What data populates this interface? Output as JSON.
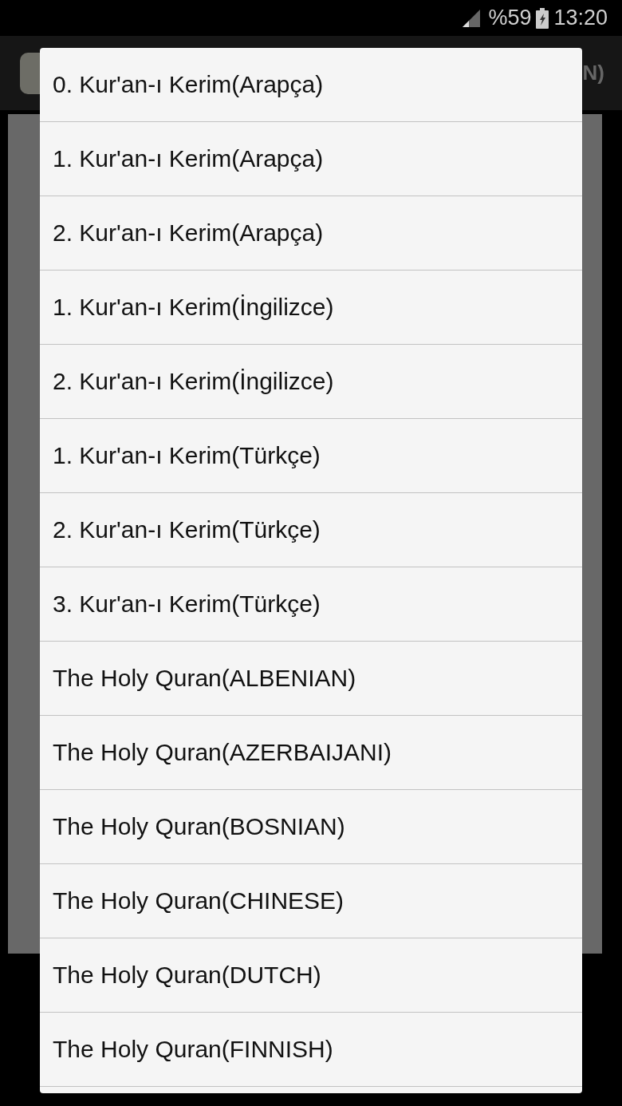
{
  "status_bar": {
    "battery": "%59",
    "time": "13:20"
  },
  "app_bar": {
    "title_fragment": "N)"
  },
  "dialog": {
    "items": [
      {
        "label": "0. Kur'an-ı Kerim(Arapça)"
      },
      {
        "label": "1. Kur'an-ı Kerim(Arapça)"
      },
      {
        "label": "2. Kur'an-ı Kerim(Arapça)"
      },
      {
        "label": "1. Kur'an-ı Kerim(İngilizce)"
      },
      {
        "label": "2. Kur'an-ı Kerim(İngilizce)"
      },
      {
        "label": "1. Kur'an-ı Kerim(Türkçe)"
      },
      {
        "label": "2. Kur'an-ı Kerim(Türkçe)"
      },
      {
        "label": "3. Kur'an-ı Kerim(Türkçe)"
      },
      {
        "label": "The Holy Quran(ALBENIAN)"
      },
      {
        "label": "The Holy Quran(AZERBAIJANI)"
      },
      {
        "label": "The Holy Quran(BOSNIAN)"
      },
      {
        "label": "The Holy Quran(CHINESE)"
      },
      {
        "label": "The Holy Quran(DUTCH)"
      },
      {
        "label": "The Holy Quran(FINNISH)"
      }
    ]
  }
}
